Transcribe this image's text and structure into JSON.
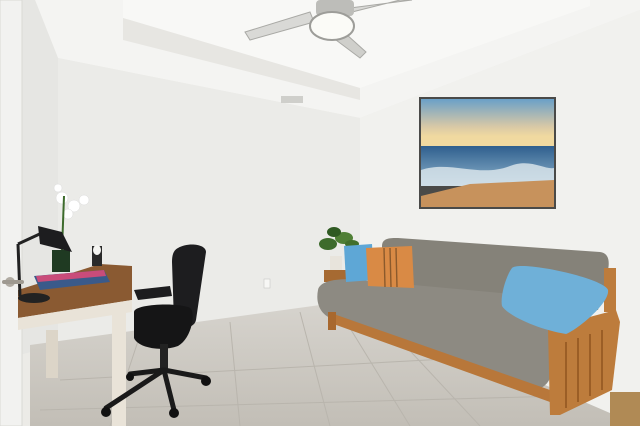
{
  "scene": {
    "colors": {
      "wall_left": "#e9e9e6",
      "wall_back": "#eeeeeb",
      "wall_right": "#f2f2ef",
      "ceiling": "#f4f4f2",
      "floor": "#cfcbc4",
      "futon_fabric": "#8a877f",
      "futon_wood": "#b8773a",
      "pillow_blue": "#6fb0d8",
      "pillow_orange": "#d98a45",
      "desk_top": "#8a5a32",
      "desk_frame": "#ebe5da",
      "chair": "#1d1d1f"
    }
  }
}
